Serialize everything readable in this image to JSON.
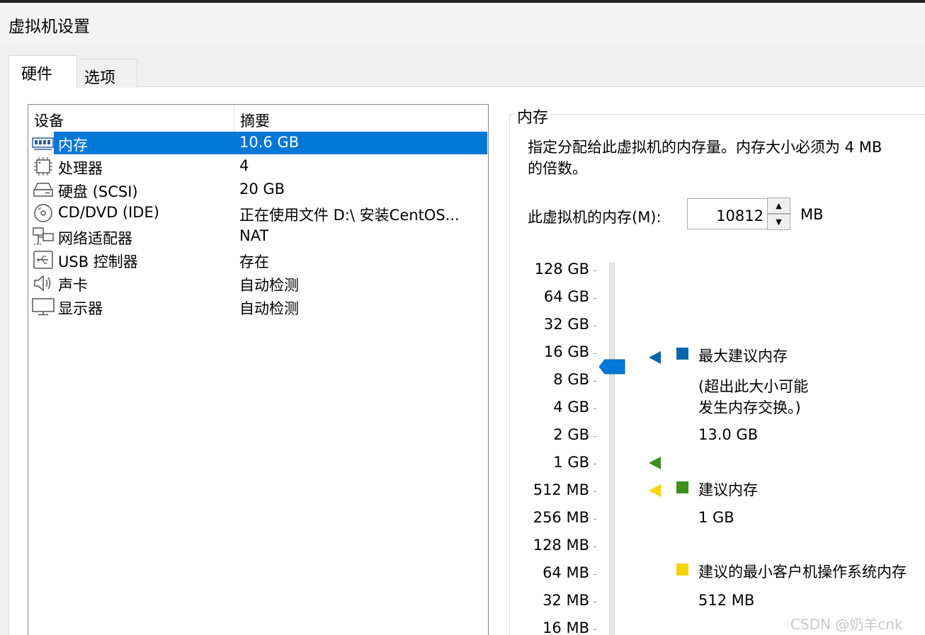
{
  "window": {
    "title": "虚拟机设置"
  },
  "tabs": [
    {
      "label": "硬件"
    },
    {
      "label": "选项"
    }
  ],
  "device_list": {
    "columns": [
      "设备",
      "摘要"
    ],
    "rows": [
      {
        "name": "内存",
        "summary": "10.6 GB",
        "icon": "memory-icon"
      },
      {
        "name": "处理器",
        "summary": "4",
        "icon": "processor-icon"
      },
      {
        "name": "硬盘 (SCSI)",
        "summary": "20 GB",
        "icon": "hard-disk-icon"
      },
      {
        "name": "CD/DVD (IDE)",
        "summary": "正在使用文件 D:\\ 安装CentOS...",
        "icon": "cd-dvd-icon"
      },
      {
        "name": "网络适配器",
        "summary": "NAT",
        "icon": "network-adapter-icon"
      },
      {
        "name": "USB 控制器",
        "summary": "存在",
        "icon": "usb-icon"
      },
      {
        "name": "声卡",
        "summary": "自动检测",
        "icon": "speaker-icon"
      },
      {
        "name": "显示器",
        "summary": "自动检测",
        "icon": "monitor-icon"
      }
    ]
  },
  "memory": {
    "group_title": "内存",
    "description_line1": "指定分配给此虚拟机的内存量。内存大小必须为 4 MB",
    "description_line2": "的倍数。",
    "label": "此虚拟机的内存(M):",
    "value": "10812",
    "unit": "MB",
    "scale": [
      "128 GB",
      "64 GB",
      "32 GB",
      "16 GB",
      "8 GB",
      "4 GB",
      "2 GB",
      "1 GB",
      "512 MB",
      "256 MB",
      "128 MB",
      "64 MB",
      "32 MB",
      "16 MB"
    ],
    "legend": {
      "max": {
        "title": "最大建议内存",
        "note1": "(超出此大小可能",
        "note2": "发生内存交换。)",
        "value": "13.0 GB",
        "color": "#0a64ad"
      },
      "recommended": {
        "title": "建议内存",
        "value": "1 GB",
        "color": "#3f8f1a"
      },
      "min": {
        "title": "建议的最小客户机操作系统内存",
        "value": "512 MB",
        "color": "#f7d400"
      }
    }
  },
  "watermark": "CSDN @奶羊cnk"
}
